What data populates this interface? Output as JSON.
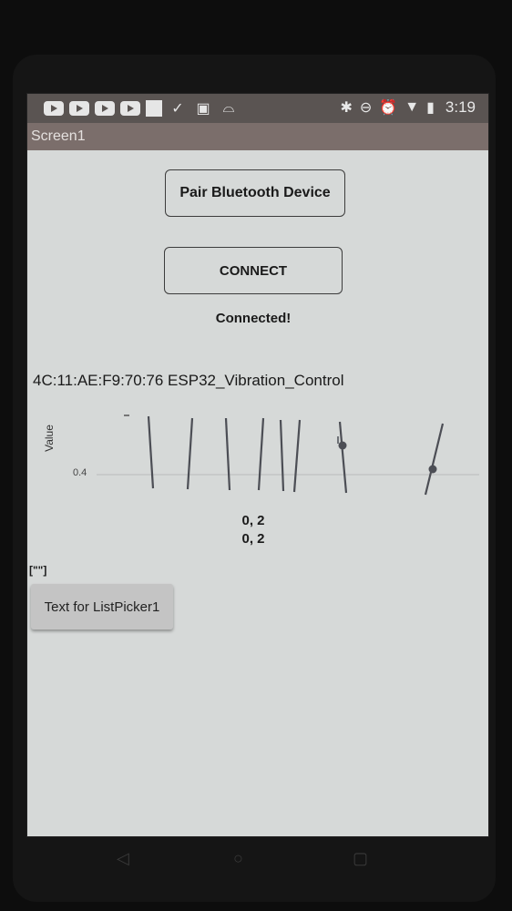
{
  "status_bar": {
    "notification_icons": [
      "youtube-icon",
      "youtube-icon",
      "youtube-icon",
      "youtube-icon",
      "image-placeholder-icon",
      "check-icon",
      "photo-icon",
      "cloud-icon"
    ],
    "system_icons": [
      "bluetooth-icon",
      "do-not-disturb-icon",
      "alarm-icon",
      "wifi-icon",
      "battery-icon"
    ],
    "time": "3:19"
  },
  "app": {
    "title": "Screen1"
  },
  "buttons": {
    "pair": "Pair Bluetooth Device",
    "connect": "CONNECT"
  },
  "connection_status": "Connected!",
  "device_label": "4C:11:AE:F9:70:76 ESP32_Vibration_Control",
  "chart_data": {
    "type": "line",
    "ylabel": "Value",
    "y_tick_labels": [
      "0.4"
    ],
    "reference_line": 0.4,
    "series_note": ""
  },
  "values": [
    "0, 2",
    "0, 2"
  ],
  "list_label": "[\"\"]",
  "list_picker": "Text for ListPicker1",
  "nav_bar": {
    "back": "◁",
    "home": "○",
    "recent": "▢"
  }
}
